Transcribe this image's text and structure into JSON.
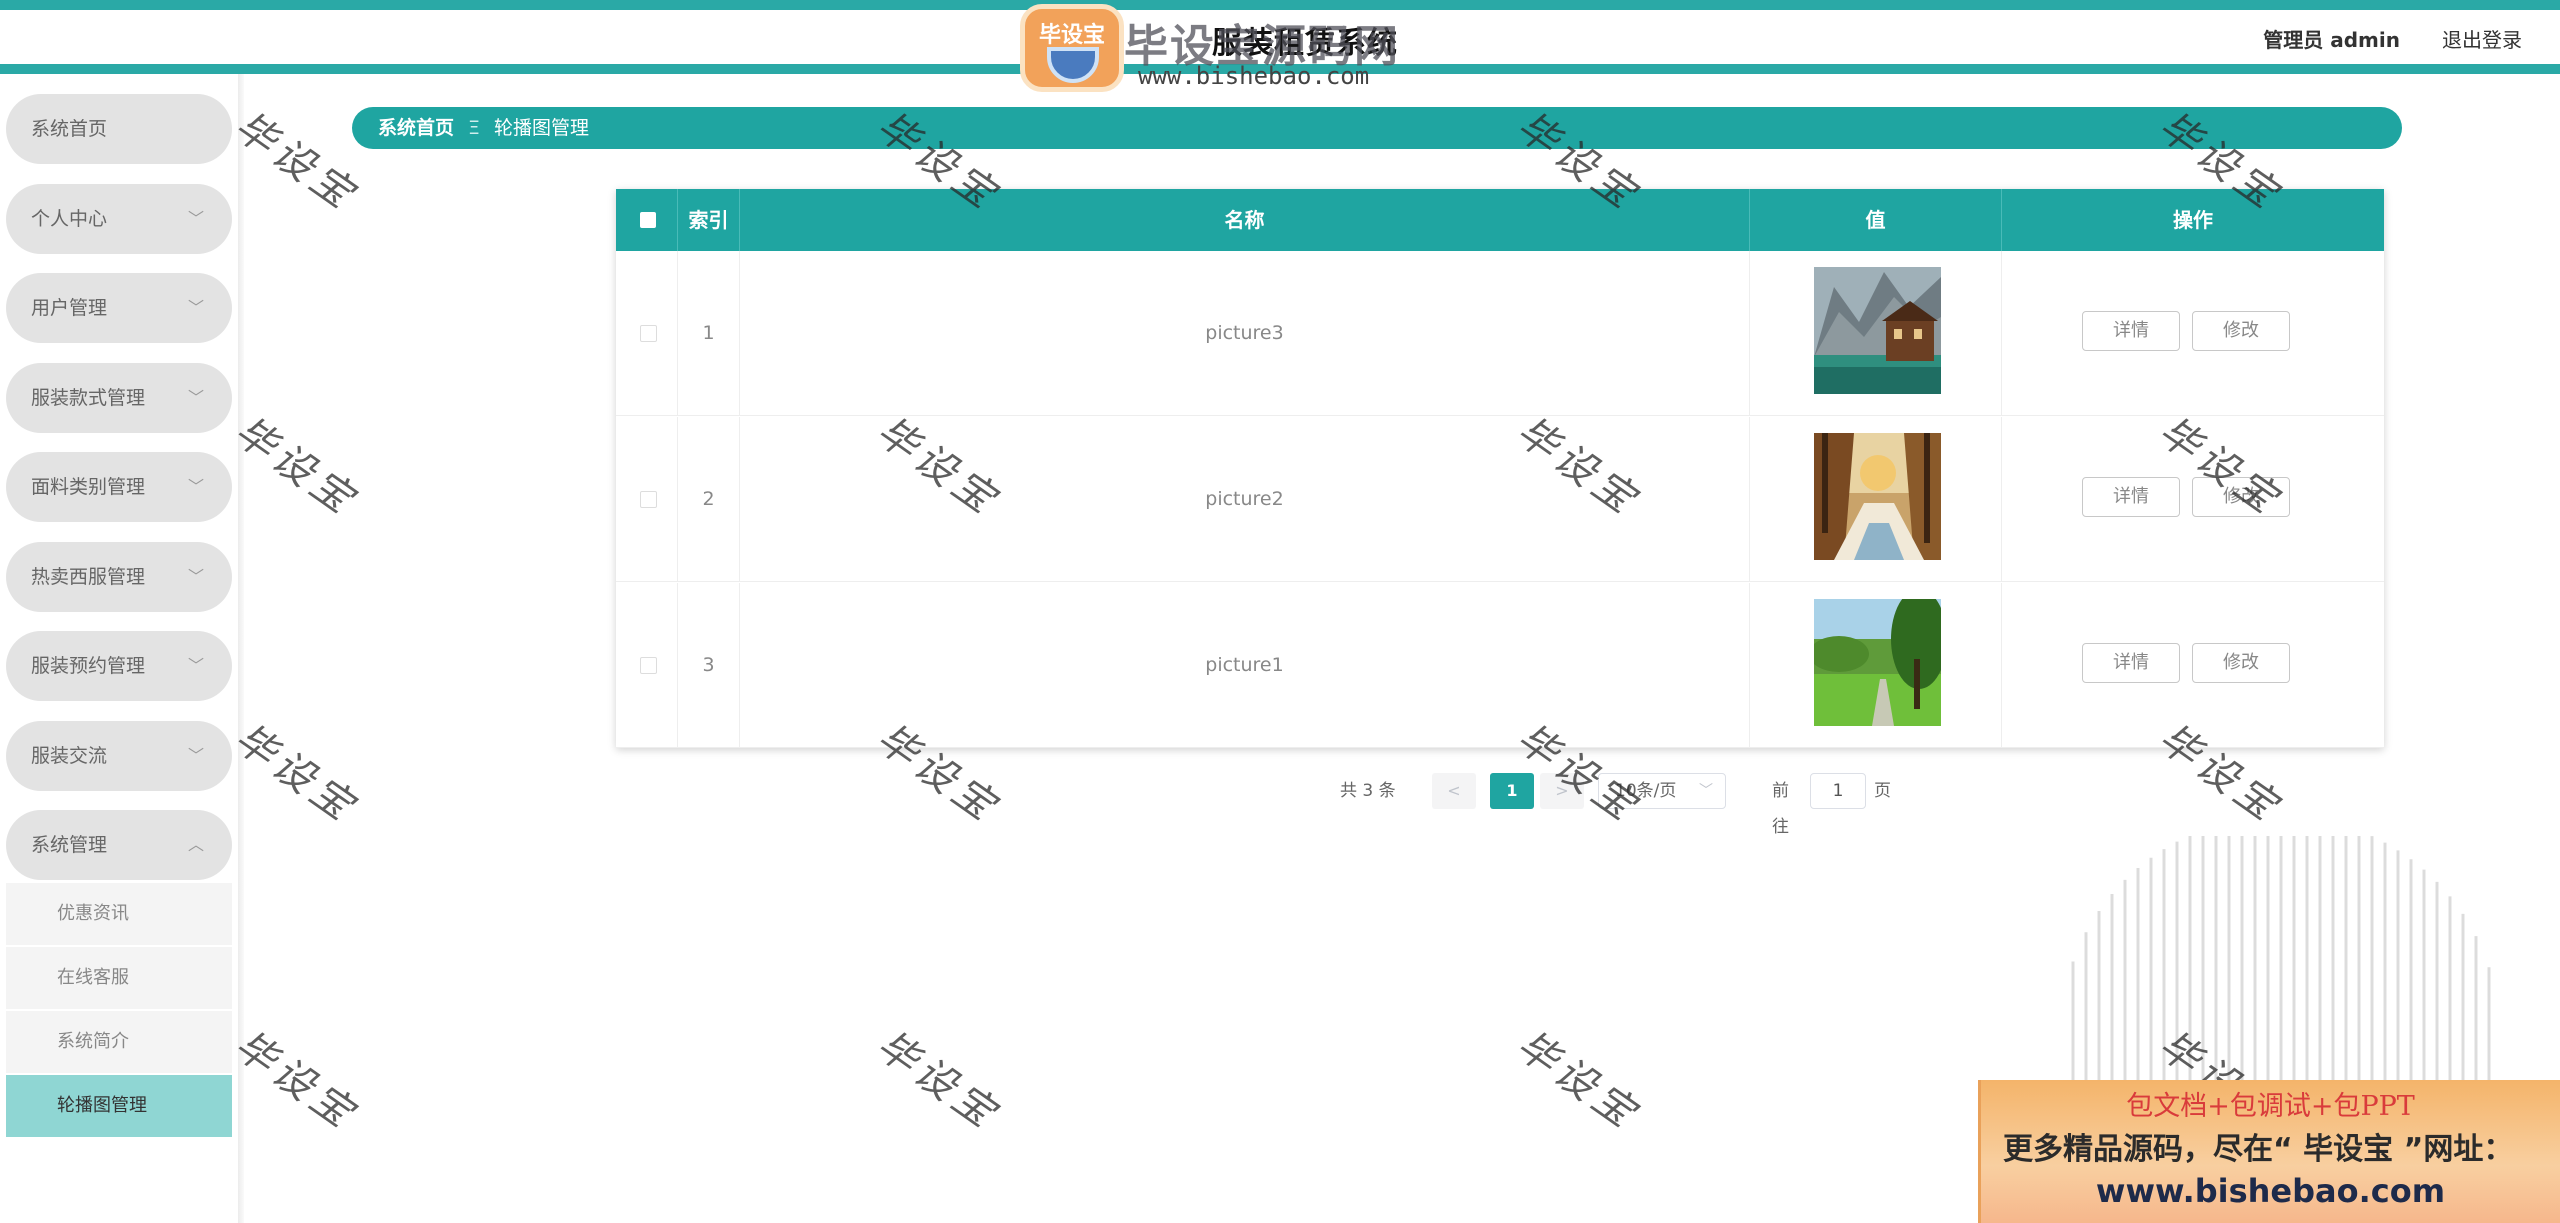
{
  "header": {
    "site_title": "服装租赁系统",
    "user": "管理员 admin",
    "logout": "退出登录",
    "colors": {
      "accent": "#2aa9a6"
    }
  },
  "logo": {
    "badge_text": "毕设宝",
    "name": "毕设宝源码网",
    "url": "www.bishebao.com"
  },
  "sidebar": {
    "items": [
      {
        "label": "系统首页",
        "expandable": false
      },
      {
        "label": "个人中心",
        "expandable": true
      },
      {
        "label": "用户管理",
        "expandable": true
      },
      {
        "label": "服装款式管理",
        "expandable": true
      },
      {
        "label": "面料类别管理",
        "expandable": true
      },
      {
        "label": "热卖西服管理",
        "expandable": true
      },
      {
        "label": "服装预约管理",
        "expandable": true
      },
      {
        "label": "服装交流",
        "expandable": true
      },
      {
        "label": "系统管理",
        "expandable": true,
        "expanded": true
      }
    ],
    "submenu": [
      {
        "label": "优惠资讯",
        "active": false
      },
      {
        "label": "在线客服",
        "active": false
      },
      {
        "label": "系统简介",
        "active": false
      },
      {
        "label": "轮播图管理",
        "active": true
      }
    ]
  },
  "breadcrumb": {
    "home": "系统首页",
    "separator": "Ξ",
    "current": "轮播图管理"
  },
  "table": {
    "columns": {
      "index": "索引",
      "name": "名称",
      "value": "值",
      "operation": "操作"
    },
    "rows": [
      {
        "index": "1",
        "name": "picture3",
        "image": "mountain-lake-cabin"
      },
      {
        "index": "2",
        "name": "picture2",
        "image": "autumn-river-trees"
      },
      {
        "index": "3",
        "name": "picture1",
        "image": "green-park-path"
      }
    ],
    "detail_label": "详情",
    "edit_label": "修改"
  },
  "pagination": {
    "total": "共 3 条",
    "prev": "<",
    "page": "1",
    "next": ">",
    "page_size": "10条/页",
    "goto_label": "前往",
    "goto_value": "1",
    "goto_unit": "页"
  },
  "watermark": {
    "text": "毕设宝"
  },
  "promo": {
    "line1": "包文档+包调试+包PPT",
    "line2": "更多精品源码，尽在“ 毕设宝 ”网址：",
    "line3": "www.bishebao.com"
  }
}
